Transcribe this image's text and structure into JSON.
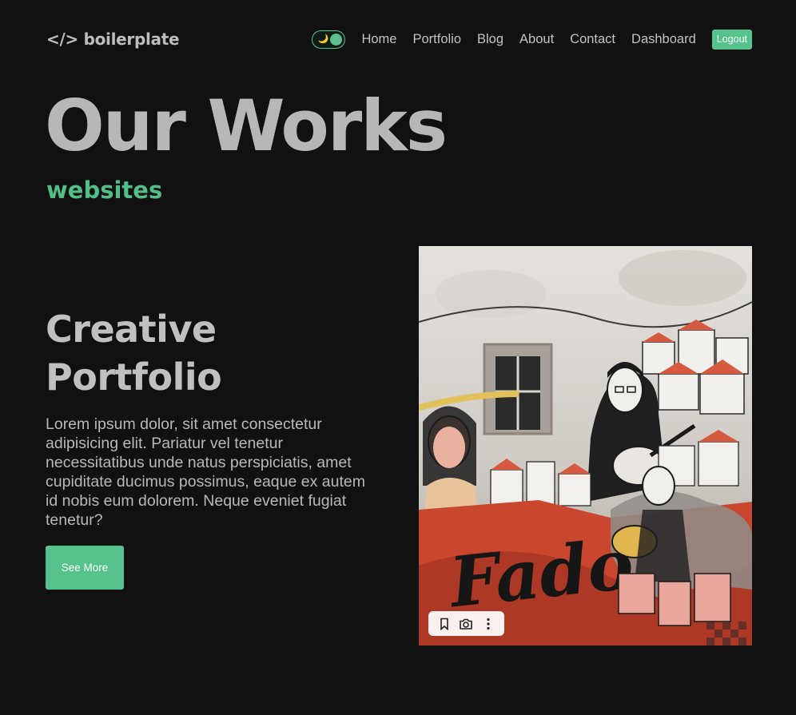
{
  "header": {
    "logo": "</> boilerplate",
    "theme_toggle_icon": "🌙",
    "nav": [
      {
        "label": "Home"
      },
      {
        "label": "Portfolio"
      },
      {
        "label": "Blog"
      },
      {
        "label": "About"
      },
      {
        "label": "Contact"
      },
      {
        "label": "Dashboard"
      }
    ],
    "logout_label": "Logout"
  },
  "hero": {
    "title": "Our Works",
    "subtitle": "websites"
  },
  "item": {
    "title": "Creative Portfolio",
    "description": "Lorem ipsum dolor, sit amet consectetur adipisicing elit. Pariatur vel tenetur necessitatibus unde natus perspiciatis, amet cupiditate ducimus possimus, eaque ex autem id nobis eum dolorem. Neque eveniet fugiat tenetur?",
    "button_label": "See More",
    "image": {
      "mural_text": "Fado",
      "toolbar_icons": [
        "bookmark-icon",
        "camera-icon",
        "more-vertical-icon"
      ]
    }
  },
  "colors": {
    "background": "#111111",
    "accent": "#56c28c",
    "text": "#b8b8b8"
  }
}
